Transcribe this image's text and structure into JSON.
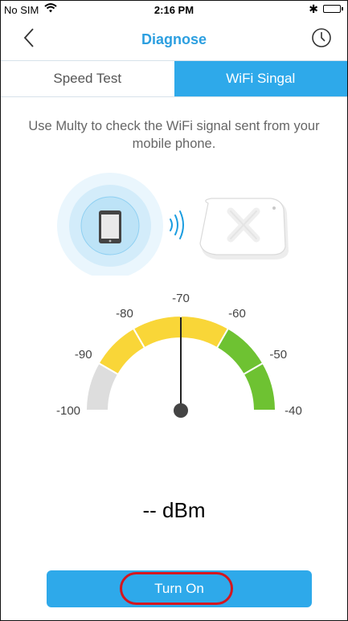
{
  "status_bar": {
    "carrier": "No SIM",
    "time": "2:16 PM"
  },
  "header": {
    "title": "Diagnose",
    "back_icon": "chevron-left-icon",
    "history_icon": "clock-icon"
  },
  "tabs": [
    {
      "label": "Speed Test",
      "selected": false
    },
    {
      "label": "WiFi Singal",
      "selected": true
    }
  ],
  "description": "Use Multy to check the WiFi signal sent from your mobile phone.",
  "gauge": {
    "ticks": [
      {
        "label": "-100"
      },
      {
        "label": "-90"
      },
      {
        "label": "-80"
      },
      {
        "label": "-70"
      },
      {
        "label": "-60"
      },
      {
        "label": "-50"
      },
      {
        "label": "-40"
      }
    ],
    "range": [
      -100,
      -40
    ],
    "needle_value": -70,
    "segment_colors": [
      "#dddddd",
      "#f9d638",
      "#f9d638",
      "#f9d638",
      "#6ec232",
      "#6ec232"
    ]
  },
  "reading": "-- dBm",
  "primary_button": {
    "label": "Turn On"
  },
  "colors": {
    "accent": "#2ea9ea",
    "title": "#2c9fe0",
    "highlight": "#d4161f"
  }
}
